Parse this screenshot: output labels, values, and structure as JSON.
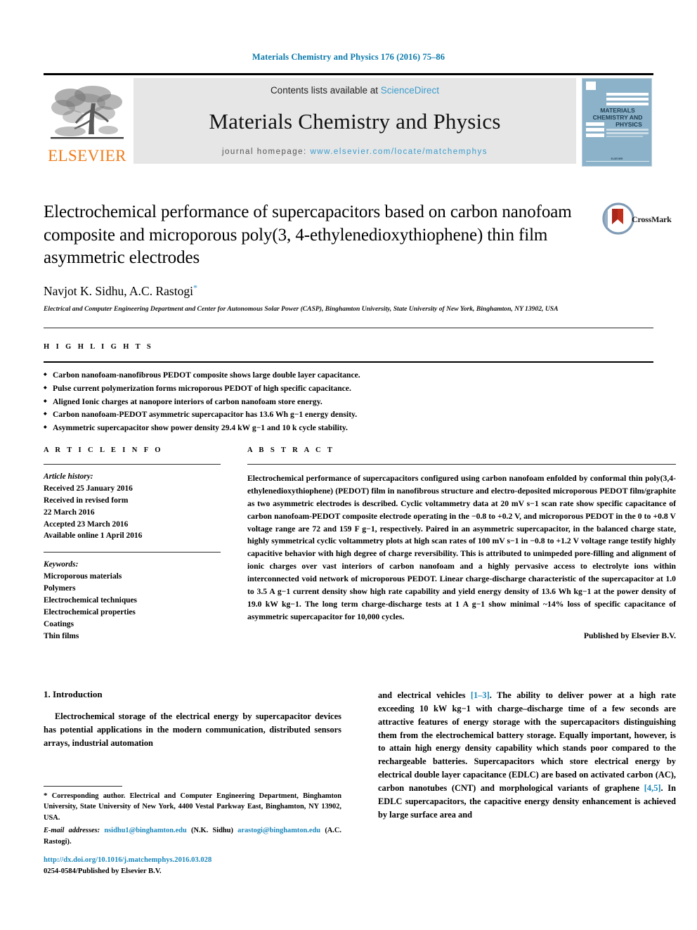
{
  "running_head": "Materials Chemistry and Physics 176 (2016) 75–86",
  "masthead": {
    "contents_prefix": "Contents lists available at ",
    "contents_link": "ScienceDirect",
    "journal_name": "Materials Chemistry and Physics",
    "homepage_prefix": "journal homepage: ",
    "homepage_link": "www.elsevier.com/locate/matchemphys",
    "publisher_wordmark": "ELSEVIER",
    "publisher_logo_icon": "elsevier-tree-icon",
    "cover": {
      "line1": "MATERIALS",
      "line2": "CHEMISTRY AND",
      "line3": "PHYSICS",
      "footer": "ELSEVIER",
      "accent_color": "#8cb2c9"
    }
  },
  "article": {
    "title": "Electrochemical performance of supercapacitors based on carbon nanofoam composite and microporous poly(3, 4-ethylenedioxythiophene) thin film asymmetric electrodes",
    "authors": "Navjot K. Sidhu, A.C. Rastogi",
    "corresponding_marker": "*",
    "affiliation": "Electrical and Computer Engineering Department and Center for Autonomous Solar Power (CASP), Binghamton University, State University of New York, Binghamton, NY 13902, USA",
    "crossmark_label": "CrossMark"
  },
  "highlights": {
    "heading": "H I G H L I G H T S",
    "items": [
      "Carbon nanofoam-nanofibrous PEDOT composite shows large double layer capacitance.",
      "Pulse current polymerization forms microporous PEDOT of high specific capacitance.",
      "Aligned Ionic charges at nanopore interiors of carbon nanofoam store energy.",
      "Carbon nanofoam-PEDOT asymmetric supercapacitor has 13.6 Wh g−1 energy density.",
      "Asymmetric supercapacitor show power density 29.4 kW g−1 and 10 k cycle stability."
    ]
  },
  "article_info": {
    "heading": "A R T I C L E   I N F O",
    "history_label": "Article history:",
    "history": [
      "Received 25 January 2016",
      "Received in revised form",
      "22 March 2016",
      "Accepted 23 March 2016",
      "Available online 1 April 2016"
    ],
    "keywords_label": "Keywords:",
    "keywords": [
      "Microporous materials",
      "Polymers",
      "Electrochemical techniques",
      "Electrochemical properties",
      "Coatings",
      "Thin films"
    ]
  },
  "abstract": {
    "heading": "A B S T R A C T",
    "text": "Electrochemical performance of supercapacitors configured using carbon nanofoam enfolded by conformal thin poly(3,4-ethylenedioxythiophene) (PEDOT) film in nanofibrous structure and electro-deposited microporous PEDOT film/graphite as two asymmetric electrodes is described. Cyclic voltammetry data at 20 mV s−1 scan rate show specific capacitance of carbon nanofoam-PEDOT composite electrode operating in the −0.8 to +0.2 V, and microporous PEDOT in the 0 to +0.8 V voltage range are 72 and 159 F g−1, respectively. Paired in an asymmetric supercapacitor, in the balanced charge state, highly symmetrical cyclic voltammetry plots at high scan rates of 100 mV s−1 in −0.8 to +1.2 V voltage range testify highly capacitive behavior with high degree of charge reversibility. This is attributed to unimpeded pore-filling and alignment of ionic charges over vast interiors of carbon nanofoam and a highly pervasive access to electrolyte ions within interconnected void network of microporous PEDOT. Linear charge-discharge characteristic of the supercapacitor at 1.0 to 3.5 A g−1 current density show high rate capability and yield energy density of 13.6 Wh kg−1 at the power density of 19.0 kW kg−1. The long term charge-discharge tests at 1 A g−1 show minimal ~14% loss of specific capacitance of asymmetric supercapacitor for 10,000 cycles.",
    "published_by": "Published by Elsevier B.V."
  },
  "body": {
    "section_number_title": "1. Introduction",
    "left_paragraph": "Electrochemical storage of the electrical energy by supercapacitor devices has potential applications in the modern communication, distributed sensors arrays, industrial automation",
    "right_paragraph_pre": "and electrical vehicles ",
    "right_ref_1": "[1–3]",
    "right_paragraph_mid": ". The ability to deliver power at a high rate exceeding 10 kW kg−1 with charge–discharge time of a few seconds are attractive features of energy storage with the supercapacitors distinguishing them from the electrochemical battery storage. Equally important, however, is to attain high energy density capability which stands poor compared to the rechargeable batteries. Supercapacitors which store electrical energy by electrical double layer capacitance (EDLC) are based on activated carbon (AC), carbon nanotubes (CNT) and morphological variants of graphene ",
    "right_ref_2": "[4,5]",
    "right_paragraph_post": ". In EDLC supercapacitors, the capacitive energy density enhancement is achieved by large surface area and"
  },
  "footnotes": {
    "corresponding_star": "*",
    "corresponding_text": " Corresponding author. Electrical and Computer Engineering Department, Binghamton University, State University of New York, 4400 Vestal Parkway East, Binghamton, NY 13902, USA.",
    "email_label": "E-mail addresses:",
    "email_1": "nsidhu1@binghamton.edu",
    "email_1_owner": "(N.K. Sidhu)",
    "email_2": "arastogi@binghamton.edu",
    "email_2_owner": "(A.C. Rastogi).",
    "doi": "http://dx.doi.org/10.1016/j.matchemphys.2016.03.028",
    "issn_line": "0254-0584/Published by Elsevier B.V."
  },
  "colors": {
    "journal_header": "#0b7aab",
    "link_blue": "#3a9ccd",
    "ref_blue": "#1b87bb",
    "elsevier_orange": "#ef7c1a",
    "masthead_bg": "#e6e6e6"
  }
}
